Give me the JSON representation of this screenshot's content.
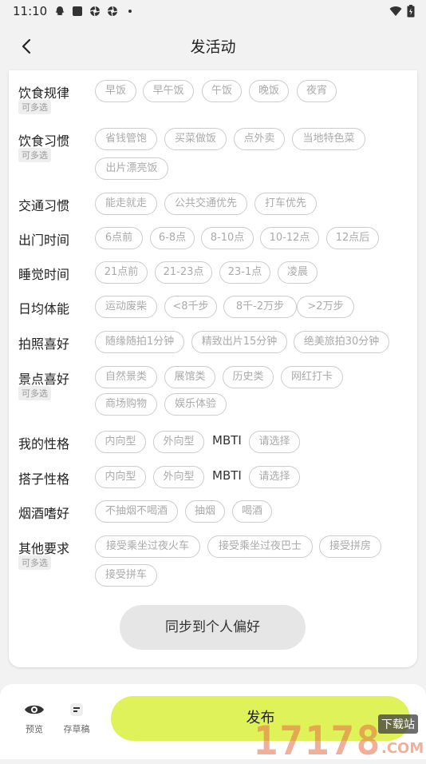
{
  "status": {
    "time": "11:10"
  },
  "nav": {
    "title": "发活动"
  },
  "rows": {
    "diet_rule": {
      "label": "饮食规律",
      "multi": "可多选",
      "chips": [
        "早饭",
        "早午饭",
        "午饭",
        "晚饭",
        "夜宵"
      ]
    },
    "diet_habit": {
      "label": "饮食习惯",
      "multi": "可多选",
      "chips": [
        "省钱管饱",
        "买菜做饭",
        "点外卖",
        "当地特色菜",
        "出片漂亮饭"
      ]
    },
    "traffic": {
      "label": "交通习惯",
      "chips": [
        "能走就走",
        "公共交通优先",
        "打车优先"
      ]
    },
    "outing": {
      "label": "出门时间",
      "chips": [
        "6点前",
        "6-8点",
        "8-10点",
        "10-12点",
        "12点后"
      ]
    },
    "sleep": {
      "label": "睡觉时间",
      "chips": [
        "21点前",
        "21-23点",
        "23-1点",
        "凌晨"
      ]
    },
    "stamina": {
      "label": "日均体能",
      "chips": [
        "运动废柴",
        "<8千步",
        "8千-2万步",
        ">2万步"
      ]
    },
    "photo": {
      "label": "拍照喜好",
      "chips": [
        "随缘随拍1分钟",
        "精致出片15分钟",
        "绝美旅拍30分钟"
      ]
    },
    "spot": {
      "label": "景点喜好",
      "multi": "可多选",
      "chips": [
        "自然景类",
        "展馆类",
        "历史类",
        "网红打卡",
        "商场购物",
        "娱乐体验"
      ]
    },
    "my_char": {
      "label": "我的性格",
      "chips": [
        "内向型",
        "外向型",
        "请选择"
      ],
      "mbti": "MBTI"
    },
    "mate_char": {
      "label": "搭子性格",
      "chips": [
        "内向型",
        "外向型",
        "请选择"
      ],
      "mbti": "MBTI"
    },
    "smoke": {
      "label": "烟酒嗜好",
      "chips": [
        "不抽烟不喝酒",
        "抽烟",
        "喝酒"
      ]
    },
    "other": {
      "label": "其他要求",
      "multi": "可多选",
      "chips": [
        "接受乘坐过夜火车",
        "接受乘坐过夜巴士",
        "接受拼房",
        "接受拼车"
      ]
    }
  },
  "sync_button": "同步到个人偏好",
  "bottom": {
    "preview": "预览",
    "draft": "存草稿",
    "publish": "发布"
  },
  "watermark": {
    "text": "17178",
    "site": "下载站",
    "suffix": ".COM"
  },
  "colors": {
    "accent": "#dff25a",
    "chip_border": "#cccccc",
    "chip_text": "#aaaaaa"
  }
}
